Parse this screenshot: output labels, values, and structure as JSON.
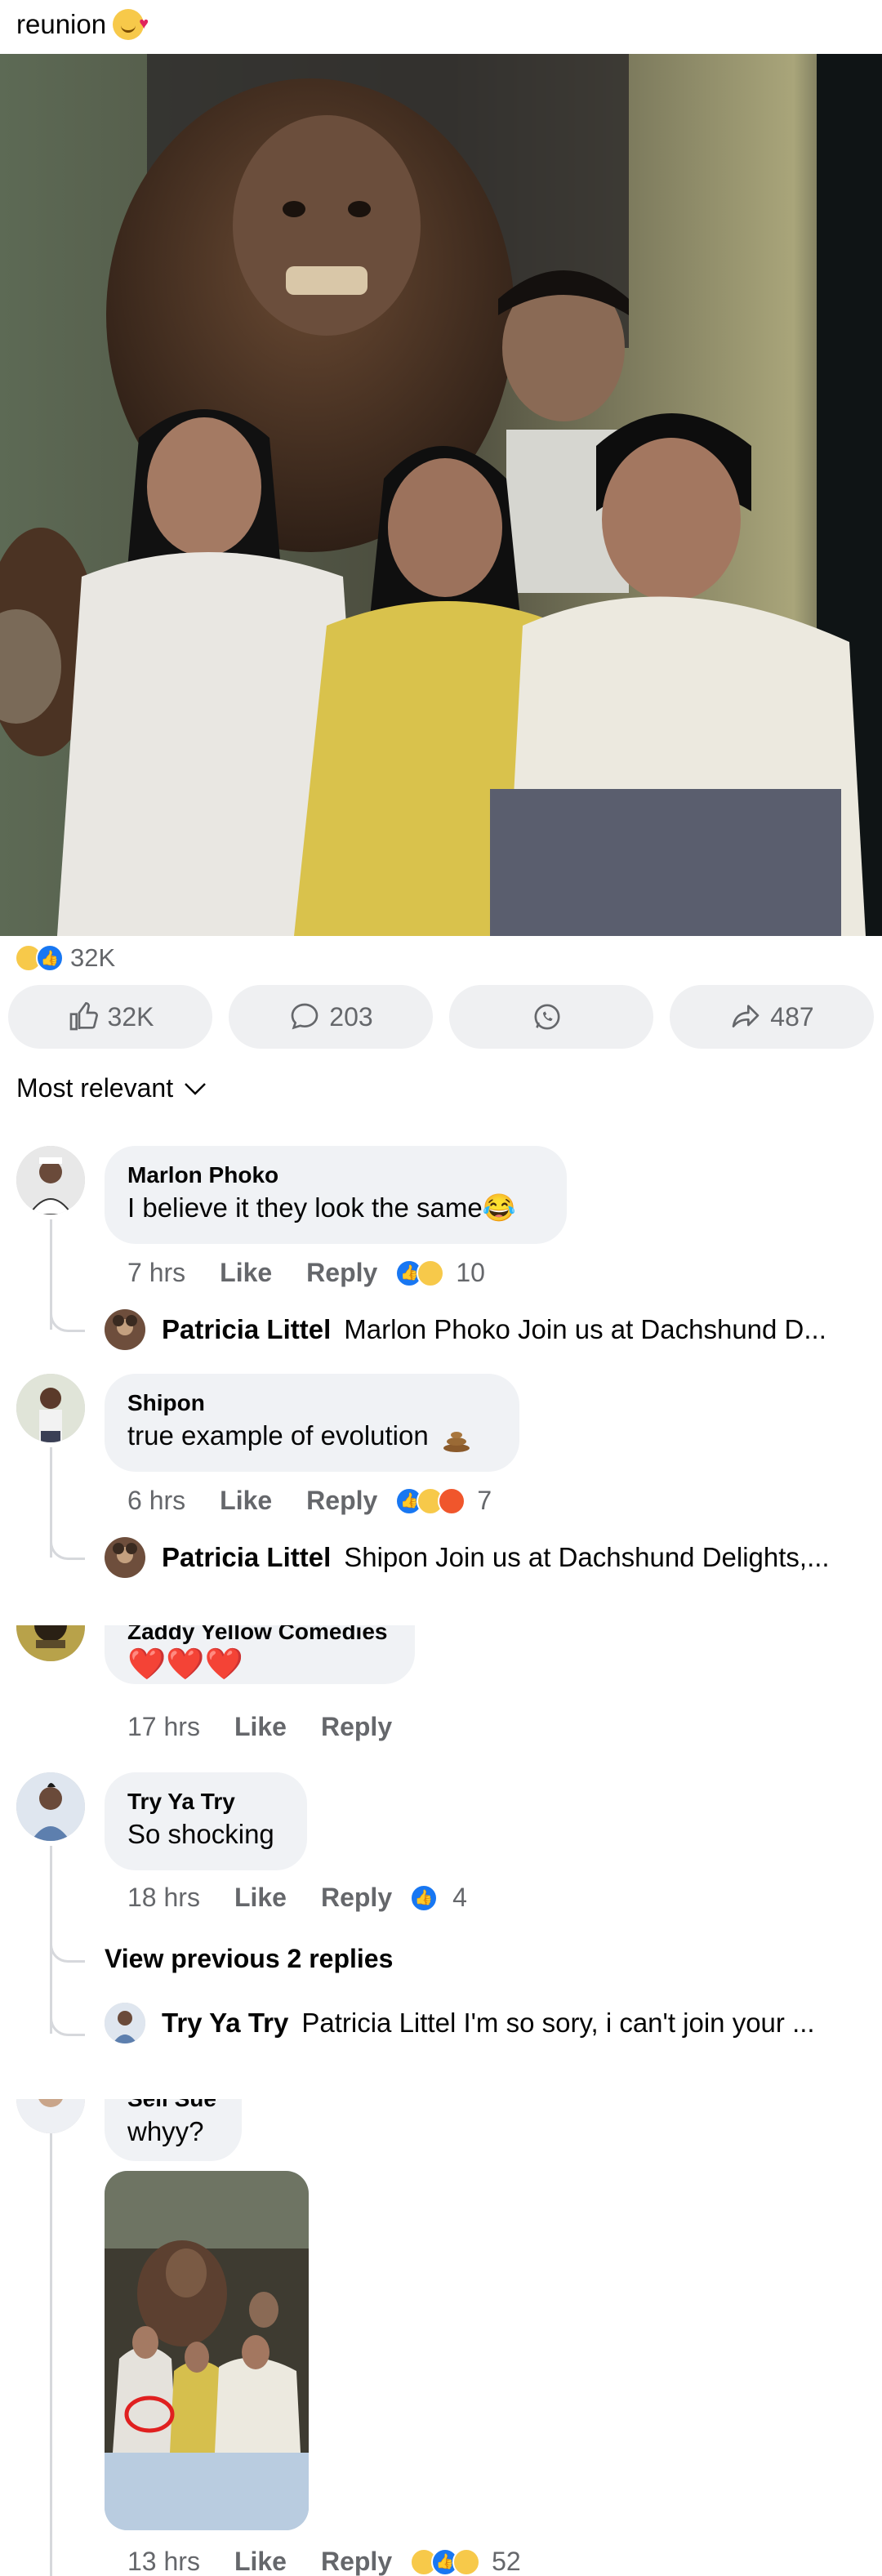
{
  "post": {
    "caption": "reunion",
    "caption_emoji": "smiling-face-with-hearts-icon",
    "reaction_total": "32K",
    "reaction_icons": [
      "haha-icon",
      "like-icon"
    ],
    "actions": {
      "like_count": "32K",
      "comment_count": "203",
      "whatsapp_label": "",
      "share_count": "487"
    },
    "sort_label": "Most relevant"
  },
  "comments": [
    {
      "name": "Marlon Phoko",
      "text": "I believe it they look the same😂",
      "time": "7 hrs",
      "like": "Like",
      "reply": "Reply",
      "reaction_count": "10",
      "reply_preview": {
        "name": "Patricia Littel",
        "text": "Marlon Phoko Join us at Dachshund D..."
      }
    },
    {
      "name": "Shipon",
      "text": "true example of evolution",
      "time": "6 hrs",
      "like": "Like",
      "reply": "Reply",
      "reaction_count": "7",
      "reply_preview": {
        "name": "Patricia Littel",
        "text": "Shipon Join us at Dachshund Delights,..."
      }
    },
    {
      "name": "Zaddy Yellow Comedies",
      "text": "❤️❤️❤️",
      "time": "17 hrs",
      "like": "Like",
      "reply": "Reply"
    },
    {
      "name": "Try Ya Try",
      "text": "So shocking",
      "time": "18 hrs",
      "like": "Like",
      "reply": "Reply",
      "reaction_count": "4",
      "view_previous": "View previous 2 replies",
      "reply_preview": {
        "name": "Try Ya Try",
        "text": "Patricia Littel I'm so sory, i can't join your ..."
      }
    },
    {
      "name": "Sell Sue",
      "text": "whyy?",
      "time": "13 hrs",
      "like": "Like",
      "reply": "Reply",
      "reaction_count": "52"
    }
  ],
  "colors": {
    "like_blue": "#1877f2",
    "bubble_bg": "#f0f2f5",
    "meta_gray": "#65676b",
    "haha_yellow": "#f7c94a",
    "angry_orange": "#f0562c",
    "heart_red": "#e01030"
  }
}
